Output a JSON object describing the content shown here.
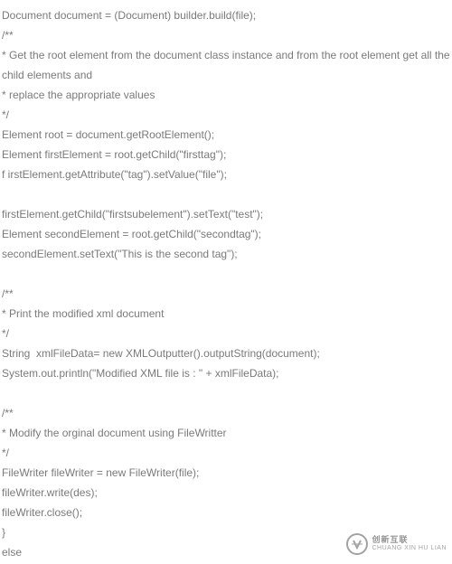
{
  "code_lines": [
    "Document document = (Document) builder.build(file);",
    "/**",
    "* Get the root element from the document class instance and from the root element get all the child elements and",
    "* replace the appropriate values",
    "*/",
    "Element root = document.getRootElement();",
    "Element firstElement = root.getChild(\"firsttag\");",
    "f irstElement.getAttribute(\"tag\").setValue(\"file\");",
    "",
    "firstElement.getChild(\"firstsubelement\").setText(\"test\");",
    "Element secondElement = root.getChild(\"secondtag\");",
    "secondElement.setText(\"This is the second tag\");",
    "",
    "/**",
    "* Print the modified xml document",
    "*/",
    "String  xmlFileData= new XMLOutputter().outputString(document);",
    "System.out.println(\"Modified XML file is : \" + xmlFileData);",
    "",
    "/**",
    "* Modify the orginal document using FileWritter",
    "*/",
    "FileWriter fileWriter = new FileWriter(file);",
    "fileWriter.write(des);",
    "fileWriter.close();",
    "}",
    "else"
  ],
  "watermark": {
    "top": "创新互联",
    "bottom": "CHUANG XIN HU LIAN"
  }
}
